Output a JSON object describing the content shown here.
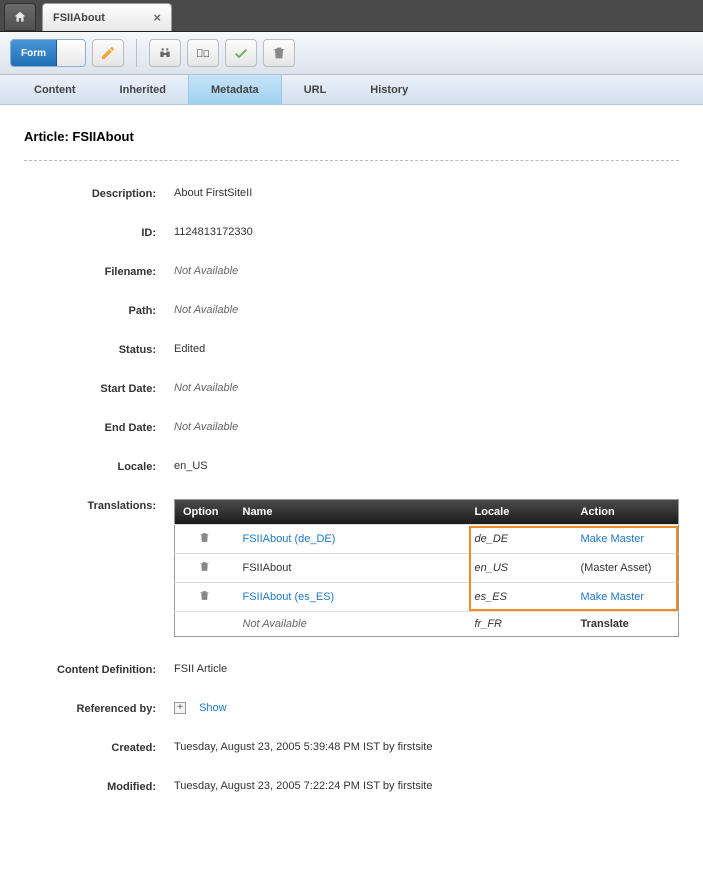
{
  "tab": {
    "label": "FSIIAbout"
  },
  "formToggle": {
    "label": "Form"
  },
  "subtabs": {
    "content": "Content",
    "inherited": "Inherited",
    "metadata": "Metadata",
    "url": "URL",
    "history": "History"
  },
  "pageTitle": "Article: FSIIAbout",
  "fields": {
    "description": {
      "label": "Description:",
      "value": "About FirstSiteII"
    },
    "id": {
      "label": "ID:",
      "value": "1124813172330"
    },
    "filename": {
      "label": "Filename:",
      "value": "Not Available",
      "na": true
    },
    "path": {
      "label": "Path:",
      "value": "Not Available",
      "na": true
    },
    "status": {
      "label": "Status:",
      "value": "Edited"
    },
    "startDate": {
      "label": "Start Date:",
      "value": "Not Available",
      "na": true
    },
    "endDate": {
      "label": "End Date:",
      "value": "Not Available",
      "na": true
    },
    "locale": {
      "label": "Locale:",
      "value": "en_US"
    },
    "translations": {
      "label": "Translations:"
    },
    "contentDef": {
      "label": "Content Definition:",
      "value": "FSII Article"
    },
    "referencedBy": {
      "label": "Referenced by:",
      "value": "Show"
    },
    "created": {
      "label": "Created:",
      "value": "Tuesday, August 23, 2005 5:39:48 PM IST by firstsite"
    },
    "modified": {
      "label": "Modified:",
      "value": "Tuesday, August 23, 2005 7:22:24 PM IST by firstsite"
    }
  },
  "transTable": {
    "headers": {
      "option": "Option",
      "name": "Name",
      "locale": "Locale",
      "action": "Action"
    },
    "rows": [
      {
        "name": "FSIIAbout (de_DE)",
        "nameLink": true,
        "locale": "de_DE",
        "action": "Make Master",
        "actionLink": true,
        "trash": true
      },
      {
        "name": "FSIIAbout",
        "nameLink": false,
        "locale": "en_US",
        "action": "(Master Asset)",
        "actionLink": false,
        "trash": true
      },
      {
        "name": "FSIIAbout (es_ES)",
        "nameLink": true,
        "locale": "es_ES",
        "action": "Make Master",
        "actionLink": true,
        "trash": true
      },
      {
        "name": "Not Available",
        "nameLink": false,
        "nameNa": true,
        "locale": "fr_FR",
        "action": "Translate",
        "actionLink": false,
        "actionBold": true,
        "trash": false
      }
    ]
  }
}
